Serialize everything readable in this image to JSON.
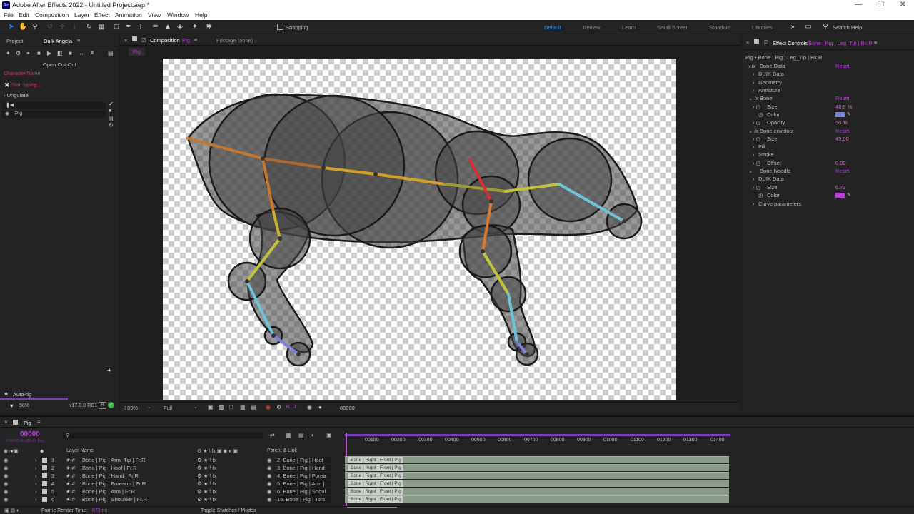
{
  "title": "Adobe After Effects 2022 - Untitled Project.aep *",
  "menu": [
    "File",
    "Edit",
    "Composition",
    "Layer",
    "Effect",
    "Animation",
    "View",
    "Window",
    "Help"
  ],
  "toolbar": {
    "snapping": "Snapping",
    "workspaces": [
      "Default",
      "Review",
      "Learn",
      "Small Screen",
      "Standard",
      "Libraries"
    ],
    "search_help": "Search Help"
  },
  "left_panel": {
    "tabs": [
      "Project",
      "Duik Angela"
    ],
    "open_cutout": "Open Cut-Out",
    "character_name_placeholder": "Character Name",
    "start_typing_placeholder": "Start typing...",
    "ungulate": "Ungulate",
    "pig": "Pig",
    "autorig": "Auto-rig",
    "percent": "58%",
    "version": "v17.0.0-RC1"
  },
  "comp": {
    "tab": "Composition",
    "comp_name": "Pig",
    "footage": "Footage (none)",
    "breadcrumb": "Pig",
    "zoom": "100%",
    "resolution": "Full",
    "exposure": "+0.0",
    "timecode": "00000"
  },
  "effect_controls": {
    "tab": "Effect Controls",
    "layer": "Bone | Pig | Leg_Tip | Bk.R",
    "path": "Pig • Bone | Pig | Leg_Tip | Bk.R",
    "rows": [
      {
        "label": "Bone Data",
        "fx": true,
        "reset": "Reset"
      },
      {
        "label": "DUIK Data"
      },
      {
        "label": "Geometry"
      },
      {
        "label": "Armature"
      },
      {
        "label": "Bone",
        "fx": true,
        "reset": "Reset"
      },
      {
        "label": "Size",
        "value": "46.9 %"
      },
      {
        "label": "Color"
      },
      {
        "label": "Opacity",
        "value": "50 %"
      },
      {
        "label": "Bone envelop",
        "fx": true,
        "reset": "Reset"
      },
      {
        "label": "Size",
        "value": "45.00"
      },
      {
        "label": "Fill"
      },
      {
        "label": "Stroke"
      },
      {
        "label": "Offset",
        "value": "0.00"
      },
      {
        "label": "Bone Noodle",
        "reset": "Reset"
      },
      {
        "label": "DUIK Data"
      },
      {
        "label": "Size",
        "value": "6.72"
      },
      {
        "label": "Color"
      },
      {
        "label": "Curve parameters"
      }
    ],
    "colors": {
      "bone_color": "#7b84d9",
      "noodle_color": "#b540d4"
    }
  },
  "timeline": {
    "tab": "Pig",
    "timecode": "00000",
    "timecode_sub": "0:00:00:00 (25.00 fps)",
    "col_layer": "Layer Name",
    "col_parent": "Parent & Link",
    "ruler": [
      "00100",
      "00200",
      "00300",
      "00400",
      "00500",
      "00600",
      "00700",
      "00800",
      "00900",
      "01000",
      "01100",
      "01200",
      "01300",
      "01400"
    ],
    "layers": [
      {
        "num": "1",
        "name": "Bone | Pig | Arm_Tip | Fr.R",
        "parent": "2. Bone | Pig | Hoof",
        "bar": "Bone | Right | Front | Pig"
      },
      {
        "num": "2",
        "name": "Bone | Pig | Hoof | Fr.R",
        "parent": "3. Bone | Pig | Hand",
        "bar": "Bone | Right | Front | Pig"
      },
      {
        "num": "3",
        "name": "Bone | Pig | Hand | Fr.R",
        "parent": "4. Bone | Pig | Forea",
        "bar": "Bone | Right | Front | Pig"
      },
      {
        "num": "4",
        "name": "Bone | Pig | Forearm | Fr.R",
        "parent": "5. Bone | Pig | Arm |",
        "bar": "Bone | Right | Front | Pig"
      },
      {
        "num": "5",
        "name": "Bone | Pig | Arm | Fr.R",
        "parent": "6. Bone | Pig | Shoul",
        "bar": "Bone | Right | Front | Pig"
      },
      {
        "num": "6",
        "name": "Bone | Pig | Shoulder | Fr.R",
        "parent": "15. Bone | Pig | Tors",
        "bar": "Bone | Right | Front | Pig"
      }
    ],
    "render_label": "Frame Render Time:",
    "render_value": "872ms",
    "toggle": "Toggle Switches / Modes"
  }
}
